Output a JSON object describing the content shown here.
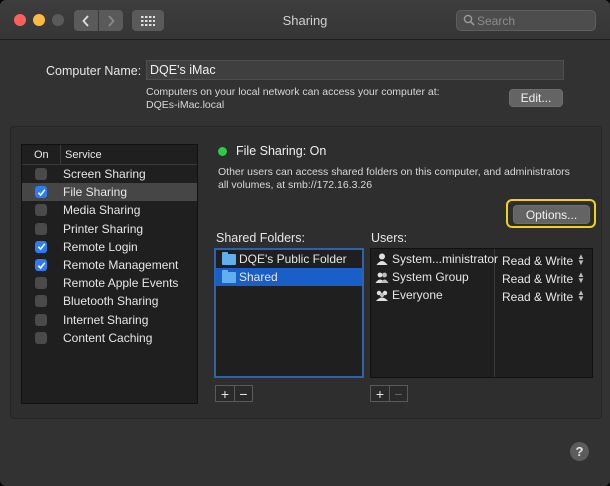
{
  "window": {
    "title": "Sharing"
  },
  "search": {
    "placeholder": "Search"
  },
  "computer": {
    "label": "Computer Name:",
    "name": "DQE's iMac",
    "desc1": "Computers on your local network can access your computer at:",
    "desc2": "DQEs-iMac.local",
    "edit_label": "Edit..."
  },
  "services": {
    "col_on": "On",
    "col_service": "Service",
    "items": [
      {
        "label": "Screen Sharing",
        "checked": false,
        "selected": false
      },
      {
        "label": "File Sharing",
        "checked": true,
        "selected": true
      },
      {
        "label": "Media Sharing",
        "checked": false,
        "selected": false
      },
      {
        "label": "Printer Sharing",
        "checked": false,
        "selected": false
      },
      {
        "label": "Remote Login",
        "checked": true,
        "selected": false
      },
      {
        "label": "Remote Management",
        "checked": true,
        "selected": false
      },
      {
        "label": "Remote Apple Events",
        "checked": false,
        "selected": false
      },
      {
        "label": "Bluetooth Sharing",
        "checked": false,
        "selected": false
      },
      {
        "label": "Internet Sharing",
        "checked": false,
        "selected": false
      },
      {
        "label": "Content Caching",
        "checked": false,
        "selected": false
      }
    ]
  },
  "file_sharing": {
    "status": "File Sharing: On",
    "status_color": "#2fcb46",
    "desc1": "Other users can access shared folders on this computer, and administrators",
    "desc2": "all volumes, at smb://172.16.3.26",
    "options_label": "Options..."
  },
  "shared_folders": {
    "label": "Shared Folders:",
    "items": [
      "DQE's Public Folder",
      "Shared"
    ]
  },
  "users": {
    "label": "Users:",
    "items": [
      {
        "name": "System...ministrator",
        "perm": "Read & Write"
      },
      {
        "name": "System Group",
        "perm": "Read & Write"
      },
      {
        "name": "Everyone",
        "perm": "Read & Write"
      }
    ]
  },
  "buttons": {
    "plus": "+",
    "minus": "−",
    "help": "?"
  },
  "colors": {
    "accent": "#2b7cf6",
    "highlight_ring": "#f1d21a",
    "selection": "#1a5fc8"
  }
}
